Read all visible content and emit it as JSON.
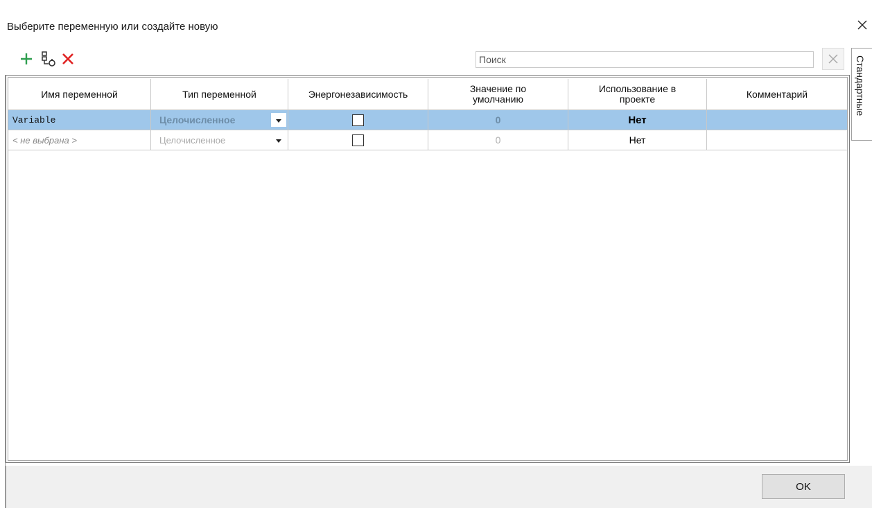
{
  "dialog": {
    "title": "Выберите переменную или создайте новую"
  },
  "toolbar": {
    "add_icon": "plus-icon",
    "link_icon": "link-variable-icon",
    "delete_icon": "delete-x-icon"
  },
  "search": {
    "placeholder": "Поиск",
    "value": ""
  },
  "side_tab": {
    "label": "Стандартные"
  },
  "table": {
    "columns": [
      "Имя переменной",
      "Тип переменной",
      "Энергонезависимость",
      "Значение по умолчанию",
      "Использование в проекте",
      "Комментарий"
    ],
    "rows": [
      {
        "name": "Variable",
        "type": "Целочисленное",
        "nonvolatile": false,
        "default": "0",
        "usage": "Нет",
        "comment": "",
        "selected": true
      },
      {
        "name": "< не выбрана >",
        "type": "Целочисленное",
        "nonvolatile": false,
        "default": "0",
        "usage": "Нет",
        "comment": "",
        "selected": false
      }
    ]
  },
  "footer": {
    "ok_label": "OK"
  },
  "colors": {
    "selection": "#9fc7ea",
    "add_green": "#2e9e4f",
    "delete_red": "#e02020"
  }
}
